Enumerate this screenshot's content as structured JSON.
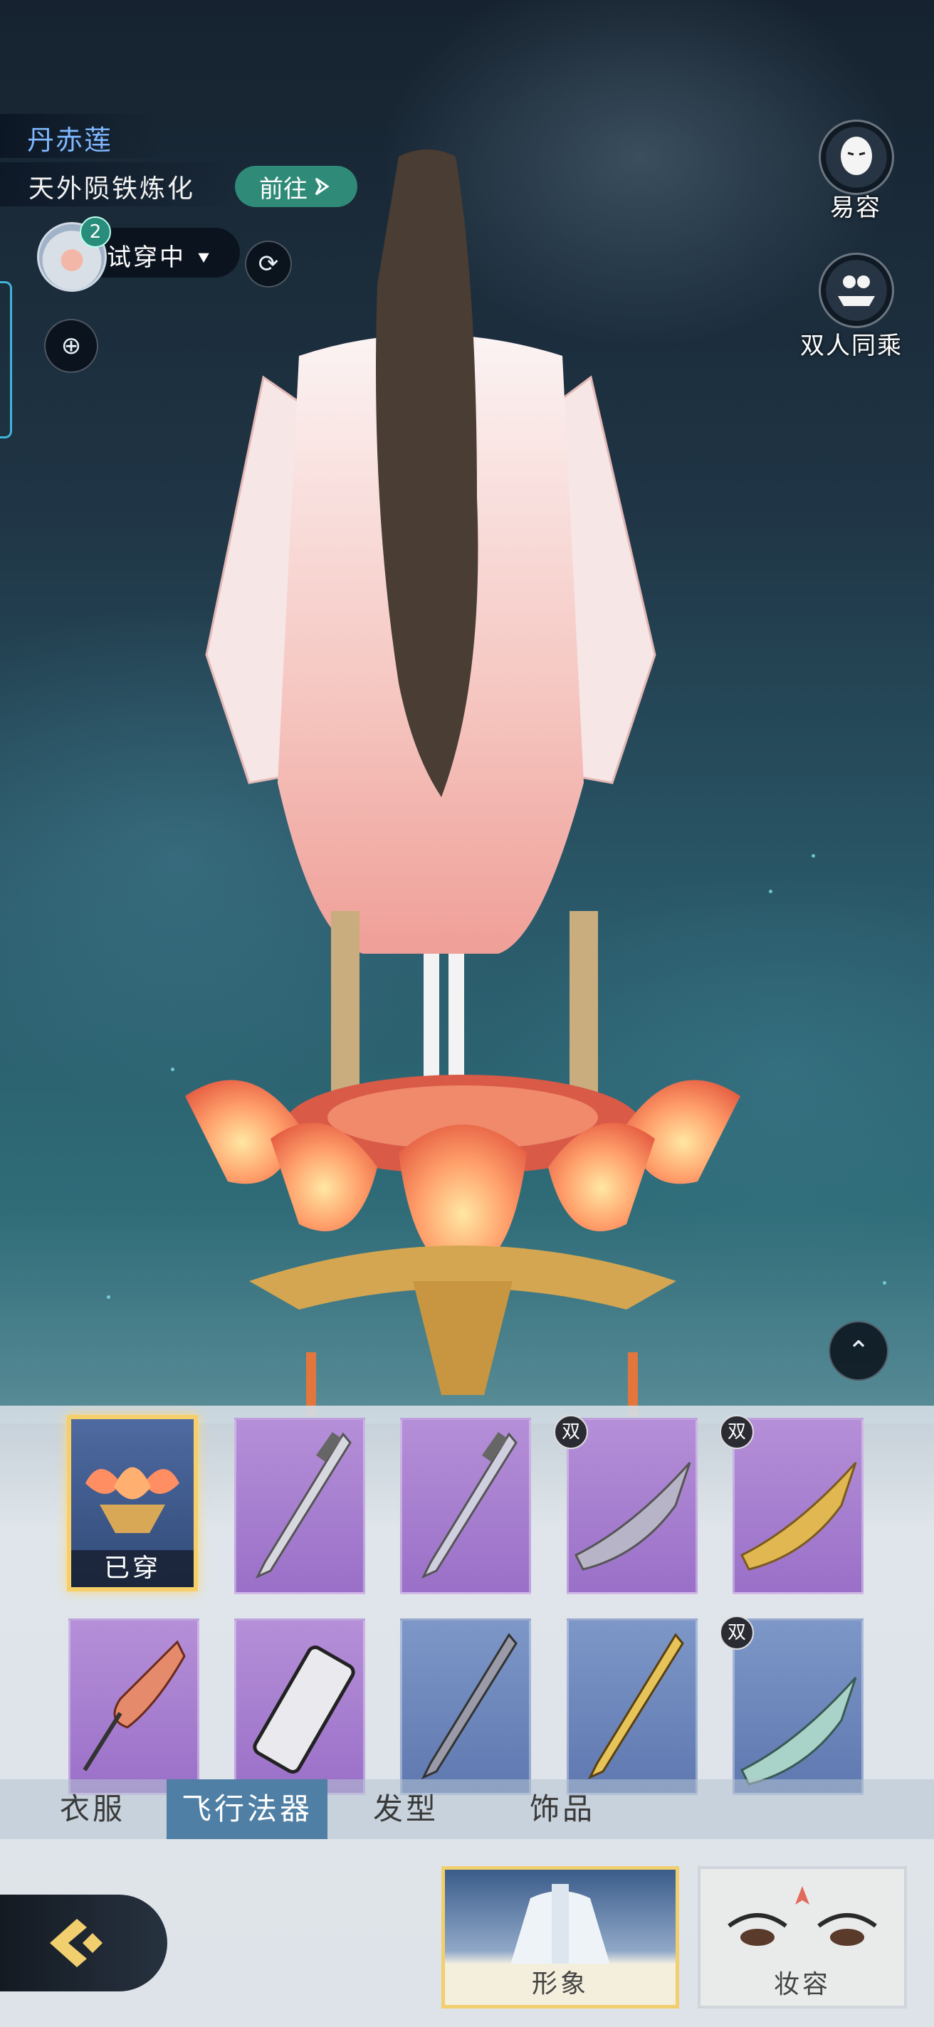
{
  "header": {
    "outfit_name": "丹赤莲",
    "subtitle": "天外陨铁炼化",
    "goto_button": "前往"
  },
  "trial": {
    "count": "2",
    "label": "试穿中"
  },
  "side_menu": {
    "appearance_label": "易容",
    "dual_ride_label": "双人同乘"
  },
  "items": {
    "worn_label": "已穿",
    "dual_badge": "双",
    "rows": [
      [
        {
          "kind": "lotus-platform",
          "rarity": "blue",
          "selected": true,
          "worn": true,
          "dual": false
        },
        {
          "kind": "sword",
          "rarity": "purple",
          "selected": false,
          "worn": false,
          "dual": false
        },
        {
          "kind": "sword",
          "rarity": "purple",
          "selected": false,
          "worn": false,
          "dual": false
        },
        {
          "kind": "flying-boat-silver",
          "rarity": "purple",
          "selected": false,
          "worn": false,
          "dual": true
        },
        {
          "kind": "flying-boat-gold",
          "rarity": "purple",
          "selected": false,
          "worn": false,
          "dual": true
        }
      ],
      [
        {
          "kind": "fan-staff",
          "rarity": "purple",
          "selected": false,
          "worn": false,
          "dual": false
        },
        {
          "kind": "scroll-device",
          "rarity": "purple",
          "selected": false,
          "worn": false,
          "dual": false
        },
        {
          "kind": "sword-dark",
          "rarity": "blue",
          "selected": false,
          "worn": false,
          "dual": false
        },
        {
          "kind": "sword-gold",
          "rarity": "blue",
          "selected": false,
          "worn": false,
          "dual": false
        },
        {
          "kind": "flying-boat-jade",
          "rarity": "blue",
          "selected": false,
          "worn": false,
          "dual": true
        }
      ]
    ]
  },
  "tabs": [
    {
      "label": "衣服",
      "active": false
    },
    {
      "label": "飞行法器",
      "active": true
    },
    {
      "label": "发型",
      "active": false
    },
    {
      "label": "饰品",
      "active": false
    }
  ],
  "modes": {
    "appearance": "形象",
    "makeup": "妆容"
  },
  "colors": {
    "accent_teal": "#2f8a78",
    "tab_active": "#4f7fa4",
    "selected_border": "#f7cf6a",
    "rarity_purple": "#a57ad0",
    "rarity_blue": "#6e88bc"
  }
}
